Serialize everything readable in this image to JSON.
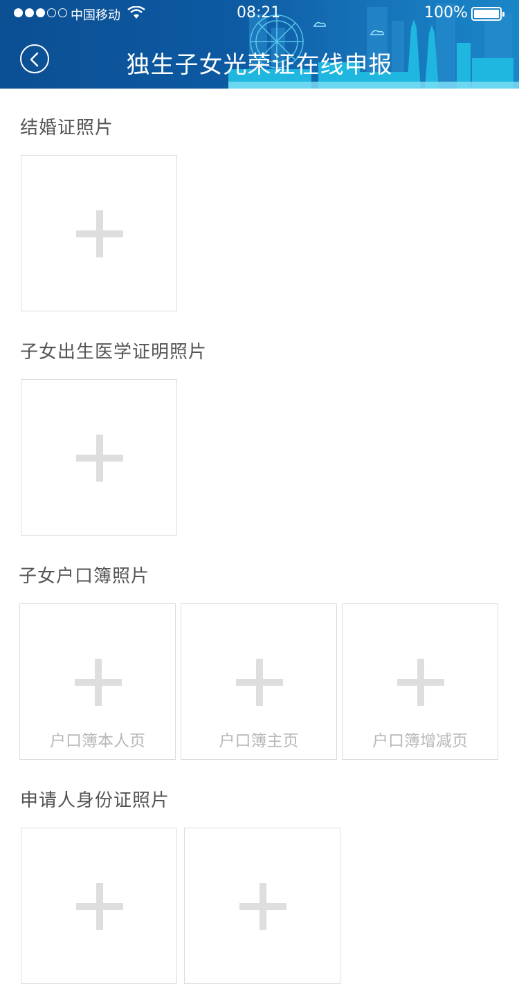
{
  "status_bar": {
    "carrier": "中国移动",
    "time": "08:21",
    "battery_percent": "100%"
  },
  "header": {
    "title": "独生子女光荣证在线申报",
    "back_icon": "chevron-left-circle-icon"
  },
  "sections": [
    {
      "label": "结婚证照片",
      "tiles": [
        {
          "caption": ""
        }
      ]
    },
    {
      "label": "子女出生医学证明照片",
      "tiles": [
        {
          "caption": ""
        }
      ]
    },
    {
      "label": "子女户口簿照片",
      "tiles": [
        {
          "caption": "户口簿本人页"
        },
        {
          "caption": "户口簿主页"
        },
        {
          "caption": "户口簿增减页"
        }
      ]
    },
    {
      "label": "申请人身份证照片",
      "tiles": [
        {
          "caption": ""
        },
        {
          "caption": ""
        }
      ]
    }
  ],
  "colors": {
    "header_blue": "#0d5aa2",
    "tile_border": "#dcdcdc",
    "plus_gray": "#dedede"
  }
}
